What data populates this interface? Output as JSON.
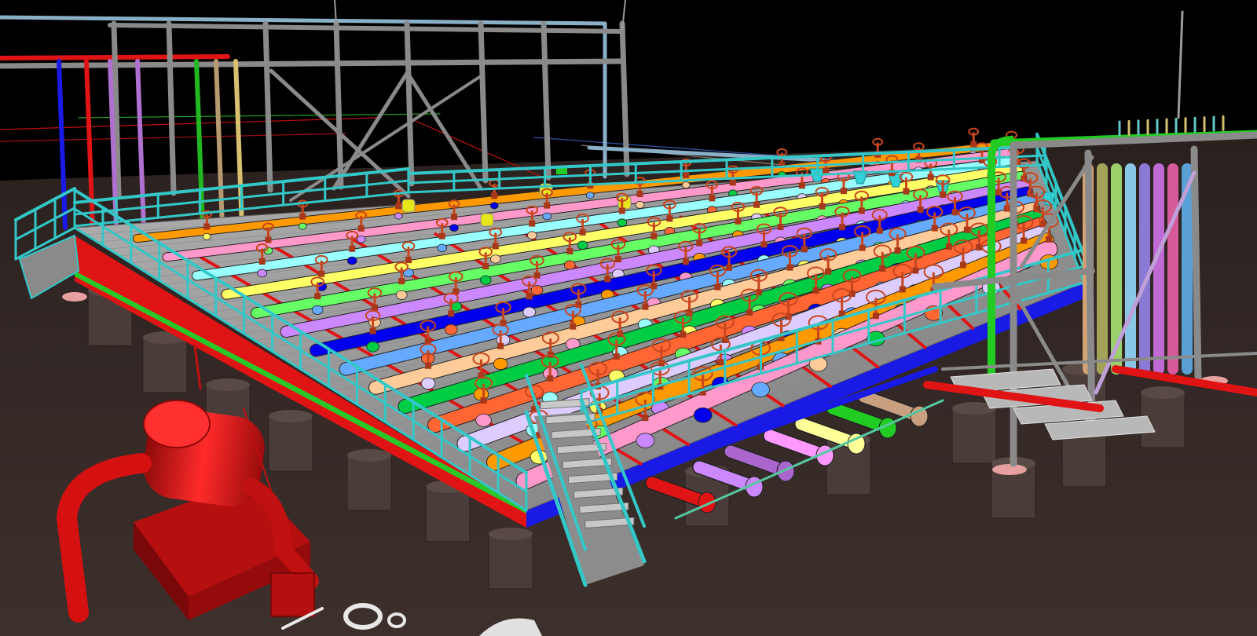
{
  "scene": {
    "kind": "3d-piping-model-render",
    "colors": {
      "sky": "#000000",
      "ground": "#3b2f2c",
      "ground_dark": "#2f2523",
      "steel": "#8a8a8a",
      "steel_dark": "#5e5e5e",
      "handrail": "#33c7c7",
      "grating": "#9a9a9a",
      "valve": "#c8461e",
      "skid_edge_red": "#e01414",
      "skid_edge_green": "#28c828",
      "skid_edge_blue": "#1a1ae6",
      "pump": "#e31717",
      "pier": "#4a3d39",
      "pier_pad": "#e6a0a0"
    },
    "pipe_palette": [
      "#ff9900",
      "#ff99cc",
      "#99ffff",
      "#ffff66",
      "#66ff66",
      "#cc88ff",
      "#0000ee",
      "#66aaff",
      "#ffcc99",
      "#00cc44",
      "#ff6633",
      "#ddccff"
    ],
    "riser_palette": [
      "#d4a373",
      "#a3a35a",
      "#9ad16b",
      "#8ac6e6",
      "#8a7ad6",
      "#c06ad6",
      "#d65a9a",
      "#5aa0d6"
    ]
  }
}
